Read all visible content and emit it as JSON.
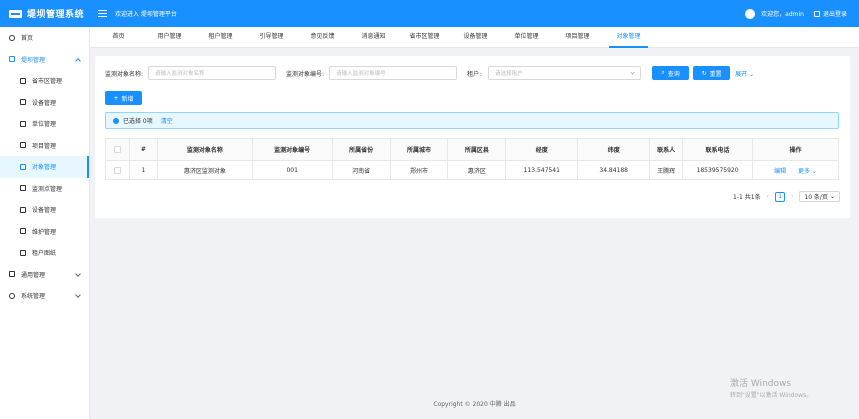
{
  "app": {
    "title": "堤坝管理系统",
    "welcome": "欢迎进入 堤坝管理平台",
    "user_greeting": "欢迎您，admin",
    "logout_label": "退出登录"
  },
  "sidebar": {
    "items": [
      {
        "label": "首页",
        "icon": "home-icon"
      },
      {
        "label": "堤坝管理",
        "icon": "file-icon"
      },
      {
        "label": "省市区管理",
        "icon": "file-icon"
      },
      {
        "label": "设备管理",
        "icon": "device-icon"
      },
      {
        "label": "单位管理",
        "icon": "file-icon"
      },
      {
        "label": "项目管理",
        "icon": "file-icon"
      },
      {
        "label": "对象管理",
        "icon": "file-icon"
      },
      {
        "label": "监测点管理",
        "icon": "file-icon"
      },
      {
        "label": "设备管理",
        "icon": "file-icon"
      },
      {
        "label": "维护管理",
        "icon": "file-icon"
      },
      {
        "label": "租户图纸",
        "icon": "file-icon"
      },
      {
        "label": "通用管理",
        "icon": "file-icon"
      },
      {
        "label": "系统管理",
        "icon": "gear-icon"
      }
    ]
  },
  "tabs": [
    "首页",
    "用户管理",
    "租户管理",
    "引导管理",
    "意见反馈",
    "消息通知",
    "省市区管理",
    "设备管理",
    "单位管理",
    "项目管理",
    "对象管理"
  ],
  "search": {
    "name_label": "监测对象名称:",
    "name_placeholder": "请输入监测对象名称",
    "code_label": "监测对象编号:",
    "code_placeholder": "请输入监测对象编号",
    "tenant_label": "租户:",
    "tenant_placeholder": "请选择租户",
    "query_label": "查询",
    "reset_label": "重置",
    "expand_label": "展开"
  },
  "toolbar": {
    "add_label": "新增"
  },
  "selection": {
    "text": "已选择 0项",
    "clear_label": "清空"
  },
  "table": {
    "columns": [
      "#",
      "监测对象名称",
      "监测对象编号",
      "所属省份",
      "所属城市",
      "所属区县",
      "经度",
      "纬度",
      "联系人",
      "联系电话",
      "操作"
    ],
    "rows": [
      {
        "index": "1",
        "name": "惠济区监测对象",
        "code": "001",
        "province": "河南省",
        "city": "郑州市",
        "district": "惠济区",
        "lng": "113.547541",
        "lat": "34.84188",
        "contact": "王腾辉",
        "phone": "18539575920",
        "edit": "编辑",
        "more": "更多"
      }
    ]
  },
  "pagination": {
    "summary": "1-1 共1条",
    "current_page": "1",
    "page_size": "10 条/页"
  },
  "footer": {
    "copyright": "Copyright © 2020 中腾 出品"
  },
  "watermark": {
    "line1": "激活 Windows",
    "line2": "转到\"设置\"以激活 Windows。"
  },
  "colors": {
    "primary": "#1890ff",
    "background": "#f0f2f5"
  }
}
